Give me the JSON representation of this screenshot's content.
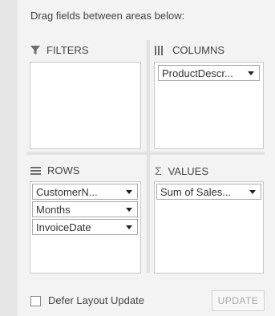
{
  "hint": "Drag fields between areas below:",
  "areas": {
    "filters": {
      "label": "FILTERS",
      "icon": "funnel-icon",
      "fields": []
    },
    "columns": {
      "label": "COLUMNS",
      "icon": "columns-icon",
      "fields": [
        "ProductDescr..."
      ]
    },
    "rows": {
      "label": "ROWS",
      "icon": "rows-icon",
      "fields": [
        "CustomerN...",
        "Months",
        "InvoiceDate"
      ]
    },
    "values": {
      "label": "VALUES",
      "icon": "sigma-icon",
      "fields": [
        "Sum of Sales..."
      ]
    }
  },
  "footer": {
    "defer_label": "Defer Layout Update",
    "defer_checked": false,
    "update_label": "UPDATE"
  }
}
